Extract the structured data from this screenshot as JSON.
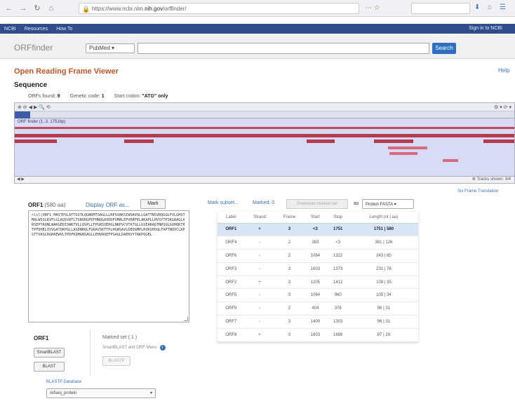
{
  "browser": {
    "url_prefix": "https://www.ncbi.nlm.",
    "url_domain": "nih.gov",
    "url_suffix": "/orffinder/"
  },
  "ncbi": {
    "brand": "NCBI",
    "resources": "Resources",
    "howto": "How To",
    "signin": "Sign in to NCBI"
  },
  "search": {
    "app_title": "ORFfinder",
    "db": "PubMed",
    "button": "Search"
  },
  "page": {
    "title": "Open Reading Frame Viewer",
    "help": "Help",
    "section": "Sequence"
  },
  "params": {
    "orfs_found_label": "ORFs found:",
    "orfs_found": "9",
    "genetic_code_label": "Genetic code:",
    "genetic_code": "1",
    "start_codon_label": "Start codon:",
    "start_codon": "\"ATG\" only"
  },
  "viewer": {
    "seq_label": "ORF finder (1..3, 1751bp)",
    "tracks": "Tracks shown: 3/4",
    "orf_link": "Six Frame Translation"
  },
  "orf_panel": {
    "title": "ORF1",
    "length": "(580 aa)",
    "display_link": "Display ORF as...",
    "mark_button": "Mark",
    "sequence": ">lcl|ORF1\nMASTPSLATTGSTLQGNKMTSAGLLLRPSVAKSIWSAVQLLGATTNSVRQGGLFVLGHSTMALWSSLKVFLGLAQSVATLTGNVRGPDFHNQGAVDDFVMALEPVRRFKLAKAPLLHVSYTPSKGAAGLVRSEPTAQNLWAKGEDISWKTVLLQSPLLFPGRSVEHGLNKPVCVTATGLLGSEAKAGTNRSGLGVHQKTRTPFDHELIVVGATQKPGLLASDNRQLFGKAVSKTTPLHGWSAVLDEDGMPLRVKSHSQLFAPTNQVCLKPSTTVASLRGHAEWVLTPDFKQMGNSAGLLEHVRQEFPSAGLDAEKVYTAKPQGEL",
    "sub_title": "ORF1",
    "smart_button": "SmartBLAST",
    "blast_button": "BLAST",
    "marked_title": "Marked set",
    "marked_count": "( 1 )",
    "marked_note": "SmartBLAST and ORF Menu",
    "blastx_button": "BLASTP",
    "blastp_label": "BLASTP Database",
    "blastp_db": "refseq_protein"
  },
  "table_controls": {
    "mark_subset": "Mark subset...",
    "marked": "Marked: 0",
    "download": "Download marked set",
    "as": "as",
    "format": "Protein FASTA"
  },
  "orf_table": {
    "headers": [
      "Label",
      "Strand",
      "Frame",
      "Start",
      "Stop",
      "Length (nt | aa)"
    ],
    "rows": [
      [
        "ORF1",
        "+",
        "3",
        "<3",
        "1751",
        "1751 | 580"
      ],
      [
        "ORF4",
        "-",
        "2",
        "383",
        "<3",
        "381 | 126"
      ],
      [
        "ORF6",
        "-",
        "2",
        "1064",
        "1322",
        "243 | 80"
      ],
      [
        "ORF3",
        "-",
        "3",
        "1603",
        "1373",
        "231 | 76"
      ],
      [
        "ORF2",
        "+",
        "3",
        "1205",
        "1412",
        "108 | 35"
      ],
      [
        "ORF5",
        "-",
        "3",
        "1064",
        "960",
        "105 | 34"
      ],
      [
        "ORF9",
        "-",
        "2",
        "404",
        "376",
        "96 | 31"
      ],
      [
        "ORF7",
        "-",
        "3",
        "1400",
        "1303",
        "96 | 31"
      ],
      [
        "ORF8",
        "+",
        "3",
        "1603",
        "1688",
        "87 | 28"
      ]
    ]
  },
  "colors": {
    "ncbi_blue": "#2f4d8a",
    "orf_red": "#b43a4e",
    "track_bg": "#d9daf4",
    "title_orange": "#c0582a",
    "link_blue": "#3a6fb0"
  }
}
